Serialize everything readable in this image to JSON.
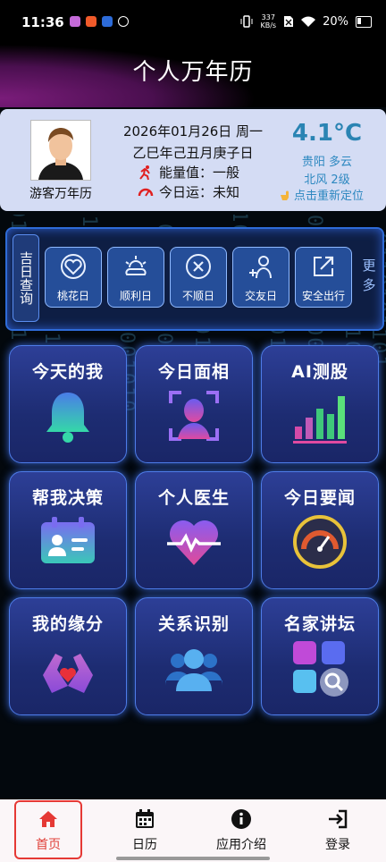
{
  "status_bar": {
    "time": "11:36",
    "net_speed_top": "337",
    "net_speed_bottom": "KB/s",
    "battery": "20%"
  },
  "header": {
    "title": "个人万年历"
  },
  "info_card": {
    "guest_name": "游客万年历",
    "date_line": "2026年01月26日 周一",
    "lunar_line": "乙巳年己丑月庚子日",
    "energy_label": "能量值：一般",
    "luck_label": "今日运：未知",
    "temperature": "4.1°C",
    "weather_line1": "贵阳 多云",
    "weather_line2": "北风 2级",
    "relocate_text": "点击重新定位"
  },
  "jiri": {
    "label": "吉日查询",
    "items": [
      {
        "label": "桃花日",
        "icon": "heart-icon"
      },
      {
        "label": "顺利日",
        "icon": "sun-cloud-icon"
      },
      {
        "label": "不顺日",
        "icon": "x-circle-icon"
      },
      {
        "label": "交友日",
        "icon": "add-friend-icon"
      },
      {
        "label": "安全出行",
        "icon": "export-icon"
      }
    ],
    "more": "更多"
  },
  "tiles": [
    {
      "label": "今天的我",
      "icon": "bell-icon"
    },
    {
      "label": "今日面相",
      "icon": "face-scan-icon"
    },
    {
      "label": "AI测股",
      "icon": "bar-chart-icon"
    },
    {
      "label": "帮我决策",
      "icon": "id-card-icon"
    },
    {
      "label": "个人医生",
      "icon": "heartbeat-icon"
    },
    {
      "label": "今日要闻",
      "icon": "gauge-icon"
    },
    {
      "label": "我的缘分",
      "icon": "hands-heart-icon"
    },
    {
      "label": "关系识别",
      "icon": "group-icon"
    },
    {
      "label": "名家讲坛",
      "icon": "apps-search-icon"
    }
  ],
  "nav": {
    "items": [
      {
        "label": "首页",
        "icon": "home-icon"
      },
      {
        "label": "日历",
        "icon": "calendar-icon"
      },
      {
        "label": "应用介绍",
        "icon": "info-icon"
      },
      {
        "label": "登录",
        "icon": "login-icon"
      }
    ],
    "active_index": 0
  },
  "colors": {
    "accent_blue": "#2a84b3",
    "active_red": "#e53935",
    "tile_bg": "#2d3f97"
  }
}
